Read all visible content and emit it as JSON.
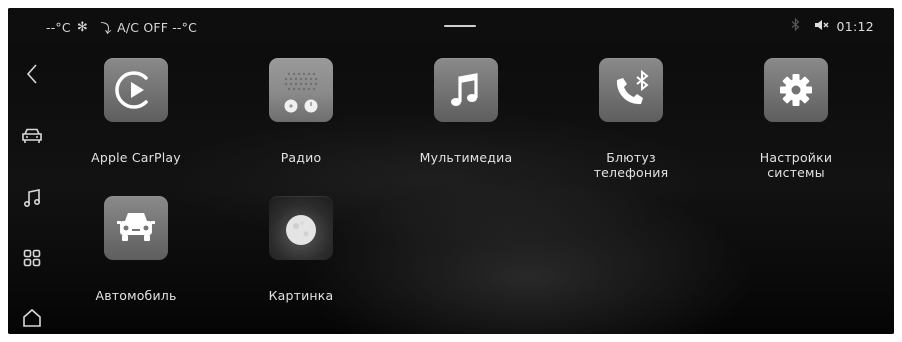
{
  "status_bar": {
    "left_temp": "--°C",
    "ac_status": "A/C OFF",
    "right_temp": "--°C",
    "clock": "01:12",
    "icons": [
      "fan-icon",
      "airflow-icon",
      "bluetooth-icon",
      "mute-icon"
    ]
  },
  "sidebar": {
    "items": [
      {
        "name": "back",
        "icon": "chevron-left-icon"
      },
      {
        "name": "car",
        "icon": "car-icon"
      },
      {
        "name": "music",
        "icon": "music-note-icon"
      },
      {
        "name": "apps",
        "icon": "grid-icon"
      },
      {
        "name": "home",
        "icon": "home-icon"
      }
    ]
  },
  "apps": [
    {
      "label": "Apple CarPlay",
      "icon": "carplay-icon"
    },
    {
      "label": "Радио",
      "icon": "radio-icon"
    },
    {
      "label": "Мультимедиа",
      "icon": "music-icon"
    },
    {
      "label": "Блютуз\nтелефония",
      "icon": "bluetooth-phone-icon"
    },
    {
      "label": "Настройки\nсистемы",
      "icon": "gear-icon"
    },
    {
      "label": "Автомобиль",
      "icon": "car-icon"
    },
    {
      "label": "Картинка",
      "icon": "moon-icon"
    }
  ],
  "colors": {
    "background": "#000000",
    "tile": "#6e6e6e",
    "text": "#e2e2e2"
  }
}
